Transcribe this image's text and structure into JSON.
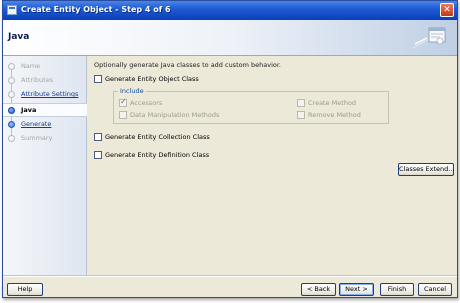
{
  "window": {
    "title": "Create Entity Object - Step 4 of 6",
    "close_glyph": "✕"
  },
  "header": {
    "title": "Java"
  },
  "nav": {
    "items": [
      {
        "label": "Name",
        "state": "completed"
      },
      {
        "label": "Attributes",
        "state": "completed"
      },
      {
        "label": "Attribute Settings",
        "state": "link"
      },
      {
        "label": "Java",
        "state": "current"
      },
      {
        "label": "Generate",
        "state": "link"
      },
      {
        "label": "Summary",
        "state": "disabled"
      }
    ]
  },
  "content": {
    "description": "Optionally generate Java classes to add custom behavior.",
    "generate_object_class": {
      "label": "Generate Entity Object Class",
      "checked": false
    },
    "include_group": {
      "legend": "Include",
      "accessors": {
        "label": "Accessors",
        "checked": true,
        "enabled": false
      },
      "data_manipulation": {
        "label": "Data Manipulation Methods",
        "checked": false,
        "enabled": false
      },
      "create_method": {
        "label": "Create Method",
        "checked": false,
        "enabled": false
      },
      "remove_method": {
        "label": "Remove Method",
        "checked": false,
        "enabled": false
      }
    },
    "generate_collection_class": {
      "label": "Generate Entity Collection Class",
      "checked": false
    },
    "generate_definition_class": {
      "label": "Generate Entity Definition Class",
      "checked": false
    },
    "classes_extend_button": "Classes Extend..."
  },
  "footer": {
    "help": "Help",
    "back": "< Back",
    "next": "Next >",
    "finish": "Finish",
    "cancel": "Cancel"
  }
}
